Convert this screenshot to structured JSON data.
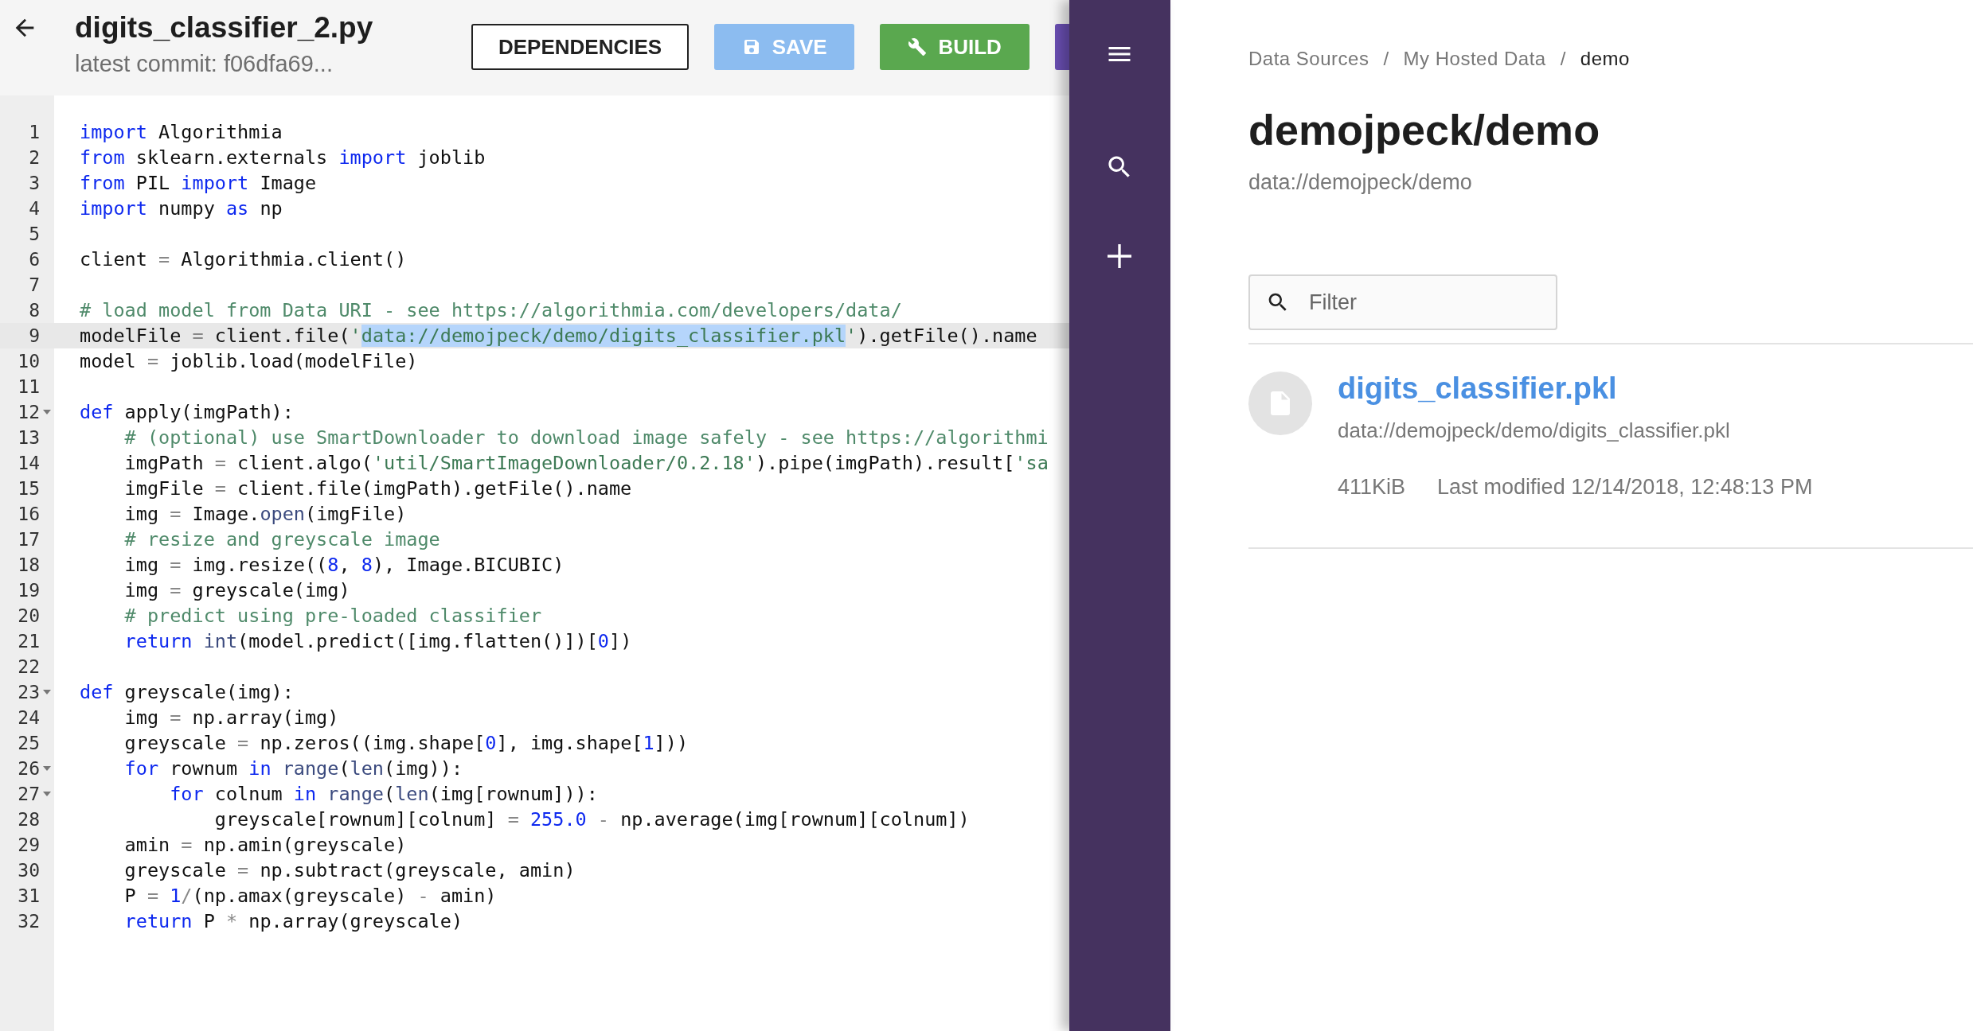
{
  "editor": {
    "file_title": "digits_classifier_2.py",
    "commit": "latest commit: f06dfa69...",
    "buttons": [
      {
        "label": "DEPENDENCIES",
        "kind": "outline",
        "disabled": false
      },
      {
        "label": "SAVE",
        "kind": "save",
        "disabled": true
      },
      {
        "label": "BUILD",
        "kind": "build",
        "disabled": false
      }
    ],
    "lines": [
      {
        "number": "1",
        "active": false,
        "foldable": false,
        "tokens": [
          {
            "kind": "kw",
            "text": "import"
          },
          {
            "kind": "plain",
            "text": " Algorithmia"
          }
        ]
      },
      {
        "number": "2",
        "active": false,
        "foldable": false,
        "tokens": [
          {
            "kind": "kw",
            "text": "from"
          },
          {
            "kind": "plain",
            "text": " sklearn.externals "
          },
          {
            "kind": "kw",
            "text": "import"
          },
          {
            "kind": "plain",
            "text": " joblib"
          }
        ]
      },
      {
        "number": "3",
        "active": false,
        "foldable": false,
        "tokens": [
          {
            "kind": "kw",
            "text": "from"
          },
          {
            "kind": "plain",
            "text": " PIL "
          },
          {
            "kind": "kw",
            "text": "import"
          },
          {
            "kind": "plain",
            "text": " Image"
          }
        ]
      },
      {
        "number": "4",
        "active": false,
        "foldable": false,
        "tokens": [
          {
            "kind": "kw",
            "text": "import"
          },
          {
            "kind": "plain",
            "text": " numpy "
          },
          {
            "kind": "kw",
            "text": "as"
          },
          {
            "kind": "plain",
            "text": " np"
          }
        ]
      },
      {
        "number": "5",
        "active": false,
        "foldable": false
      },
      {
        "number": "6",
        "active": false,
        "foldable": false,
        "tokens": [
          {
            "kind": "plain",
            "text": "client "
          },
          {
            "kind": "op",
            "text": "="
          },
          {
            "kind": "plain",
            "text": " Algorithmia.client()"
          }
        ]
      },
      {
        "number": "7",
        "active": false,
        "foldable": false
      },
      {
        "number": "8",
        "active": false,
        "foldable": false,
        "tokens": [
          {
            "kind": "comment",
            "text": "# load model from Data URI - see https://algorithmia.com/developers/data/"
          }
        ]
      },
      {
        "number": "9",
        "active": true,
        "foldable": false,
        "tokens": [
          {
            "kind": "plain",
            "text": "modelFile "
          },
          {
            "kind": "op",
            "text": "="
          },
          {
            "kind": "plain",
            "text": " client.file("
          },
          {
            "kind": "str",
            "text": "'"
          },
          {
            "kind": "selection",
            "text": "data://demojpeck/demo/digits_classifier.pkl"
          },
          {
            "kind": "str",
            "text": "'"
          },
          {
            "kind": "plain",
            "text": ").getFile().name"
          }
        ]
      },
      {
        "number": "10",
        "active": false,
        "foldable": false,
        "tokens": [
          {
            "kind": "plain",
            "text": "model "
          },
          {
            "kind": "op",
            "text": "="
          },
          {
            "kind": "plain",
            "text": " joblib.load(modelFile)"
          }
        ]
      },
      {
        "number": "11",
        "active": false,
        "foldable": false
      },
      {
        "number": "12",
        "active": false,
        "foldable": true,
        "tokens": [
          {
            "kind": "kw",
            "text": "def"
          },
          {
            "kind": "plain",
            "text": " apply(imgPath):"
          }
        ]
      },
      {
        "number": "13",
        "active": false,
        "foldable": false,
        "tokens": [
          {
            "kind": "comment",
            "text": "    # (optional) use SmartDownloader to download image safely - see https://algorithmi"
          }
        ]
      },
      {
        "number": "14",
        "active": false,
        "foldable": false,
        "tokens": [
          {
            "kind": "plain",
            "text": "    imgPath "
          },
          {
            "kind": "op",
            "text": "="
          },
          {
            "kind": "plain",
            "text": " client.algo("
          },
          {
            "kind": "str",
            "text": "'util/SmartImageDownloader/0.2.18'"
          },
          {
            "kind": "plain",
            "text": ").pipe(imgPath).result["
          },
          {
            "kind": "str",
            "text": "'sa"
          }
        ]
      },
      {
        "number": "15",
        "active": false,
        "foldable": false,
        "tokens": [
          {
            "kind": "plain",
            "text": "    imgFile "
          },
          {
            "kind": "op",
            "text": "="
          },
          {
            "kind": "plain",
            "text": " client.file(imgPath).getFile().name"
          }
        ]
      },
      {
        "number": "16",
        "active": false,
        "foldable": false,
        "tokens": [
          {
            "kind": "plain",
            "text": "    img "
          },
          {
            "kind": "op",
            "text": "="
          },
          {
            "kind": "plain",
            "text": " Image."
          },
          {
            "kind": "fn",
            "text": "open"
          },
          {
            "kind": "plain",
            "text": "(imgFile)"
          }
        ]
      },
      {
        "number": "17",
        "active": false,
        "foldable": false,
        "tokens": [
          {
            "kind": "comment",
            "text": "    # resize and greyscale image"
          }
        ]
      },
      {
        "number": "18",
        "active": false,
        "foldable": false,
        "tokens": [
          {
            "kind": "plain",
            "text": "    img "
          },
          {
            "kind": "op",
            "text": "="
          },
          {
            "kind": "plain",
            "text": " img.resize(("
          },
          {
            "kind": "num",
            "text": "8"
          },
          {
            "kind": "plain",
            "text": ", "
          },
          {
            "kind": "num",
            "text": "8"
          },
          {
            "kind": "plain",
            "text": "), Image.BICUBIC)"
          }
        ]
      },
      {
        "number": "19",
        "active": false,
        "foldable": false,
        "tokens": [
          {
            "kind": "plain",
            "text": "    img "
          },
          {
            "kind": "op",
            "text": "="
          },
          {
            "kind": "plain",
            "text": " greyscale(img)"
          }
        ]
      },
      {
        "number": "20",
        "active": false,
        "foldable": false,
        "tokens": [
          {
            "kind": "comment",
            "text": "    # predict using pre-loaded classifier"
          }
        ]
      },
      {
        "number": "21",
        "active": false,
        "foldable": false,
        "tokens": [
          {
            "kind": "kw",
            "text": "    return"
          },
          {
            "kind": "fn",
            "text": " int"
          },
          {
            "kind": "plain",
            "text": "(model.predict([img.flatten()])["
          },
          {
            "kind": "num",
            "text": "0"
          },
          {
            "kind": "plain",
            "text": "])"
          }
        ]
      },
      {
        "number": "22",
        "active": false,
        "foldable": false
      },
      {
        "number": "23",
        "active": false,
        "foldable": true,
        "tokens": [
          {
            "kind": "kw",
            "text": "def"
          },
          {
            "kind": "plain",
            "text": " greyscale(img):"
          }
        ]
      },
      {
        "number": "24",
        "active": false,
        "foldable": false,
        "tokens": [
          {
            "kind": "plain",
            "text": "    img "
          },
          {
            "kind": "op",
            "text": "="
          },
          {
            "kind": "plain",
            "text": " np.array(img)"
          }
        ]
      },
      {
        "number": "25",
        "active": false,
        "foldable": false,
        "tokens": [
          {
            "kind": "plain",
            "text": "    greyscale "
          },
          {
            "kind": "op",
            "text": "="
          },
          {
            "kind": "plain",
            "text": " np.zeros((img.shape["
          },
          {
            "kind": "num",
            "text": "0"
          },
          {
            "kind": "plain",
            "text": "], img.shape["
          },
          {
            "kind": "num",
            "text": "1"
          },
          {
            "kind": "plain",
            "text": "]))"
          }
        ]
      },
      {
        "number": "26",
        "active": false,
        "foldable": true,
        "tokens": [
          {
            "kind": "kw",
            "text": "    for"
          },
          {
            "kind": "plain",
            "text": " rownum "
          },
          {
            "kind": "kw",
            "text": "in"
          },
          {
            "kind": "fn",
            "text": " range"
          },
          {
            "kind": "plain",
            "text": "("
          },
          {
            "kind": "fn",
            "text": "len"
          },
          {
            "kind": "plain",
            "text": "(img)):"
          }
        ]
      },
      {
        "number": "27",
        "active": false,
        "foldable": true,
        "tokens": [
          {
            "kind": "kw",
            "text": "        for"
          },
          {
            "kind": "plain",
            "text": " colnum "
          },
          {
            "kind": "kw",
            "text": "in"
          },
          {
            "kind": "fn",
            "text": " range"
          },
          {
            "kind": "plain",
            "text": "("
          },
          {
            "kind": "fn",
            "text": "len"
          },
          {
            "kind": "plain",
            "text": "(img[rownum])):"
          }
        ]
      },
      {
        "number": "28",
        "active": false,
        "foldable": false,
        "tokens": [
          {
            "kind": "plain",
            "text": "            greyscale[rownum][colnum] "
          },
          {
            "kind": "op",
            "text": "="
          },
          {
            "kind": "num",
            "text": " 255.0"
          },
          {
            "kind": "op",
            "text": " -"
          },
          {
            "kind": "plain",
            "text": " np.average(img[rownum][colnum])"
          }
        ]
      },
      {
        "number": "29",
        "active": false,
        "foldable": false,
        "tokens": [
          {
            "kind": "plain",
            "text": "    amin "
          },
          {
            "kind": "op",
            "text": "="
          },
          {
            "kind": "plain",
            "text": " np.amin(greyscale)"
          }
        ]
      },
      {
        "number": "30",
        "active": false,
        "foldable": false,
        "tokens": [
          {
            "kind": "plain",
            "text": "    greyscale "
          },
          {
            "kind": "op",
            "text": "="
          },
          {
            "kind": "plain",
            "text": " np.subtract(greyscale, amin)"
          }
        ]
      },
      {
        "number": "31",
        "active": false,
        "foldable": false,
        "tokens": [
          {
            "kind": "plain",
            "text": "    P "
          },
          {
            "kind": "op",
            "text": "="
          },
          {
            "kind": "num",
            "text": " 1"
          },
          {
            "kind": "op",
            "text": "/"
          },
          {
            "kind": "plain",
            "text": "(np.amax(greyscale) "
          },
          {
            "kind": "op",
            "text": "-"
          },
          {
            "kind": "plain",
            "text": " amin)"
          }
        ]
      },
      {
        "number": "32",
        "active": false,
        "foldable": false,
        "tokens": [
          {
            "kind": "kw",
            "text": "    return"
          },
          {
            "kind": "plain",
            "text": " P "
          },
          {
            "kind": "op",
            "text": "*"
          },
          {
            "kind": "plain",
            "text": " np.array(greyscale)"
          }
        ]
      }
    ]
  },
  "data_panel": {
    "breadcrumb": [
      {
        "label": "Data Sources",
        "current": false
      },
      {
        "label": "My Hosted Data",
        "current": false
      },
      {
        "label": "demo",
        "current": true
      }
    ],
    "separators": [
      "/",
      "/"
    ],
    "title": "demojpeck/demo",
    "uri": "data://demojpeck/demo",
    "filter": {
      "placeholder": "Filter"
    },
    "files": [
      {
        "name": "digits_classifier.pkl",
        "uri": "data://demojpeck/demo/digits_classifier.pkl",
        "size": "411KiB",
        "modified": "Last modified 12/14/2018, 12:48:13 PM"
      }
    ]
  }
}
